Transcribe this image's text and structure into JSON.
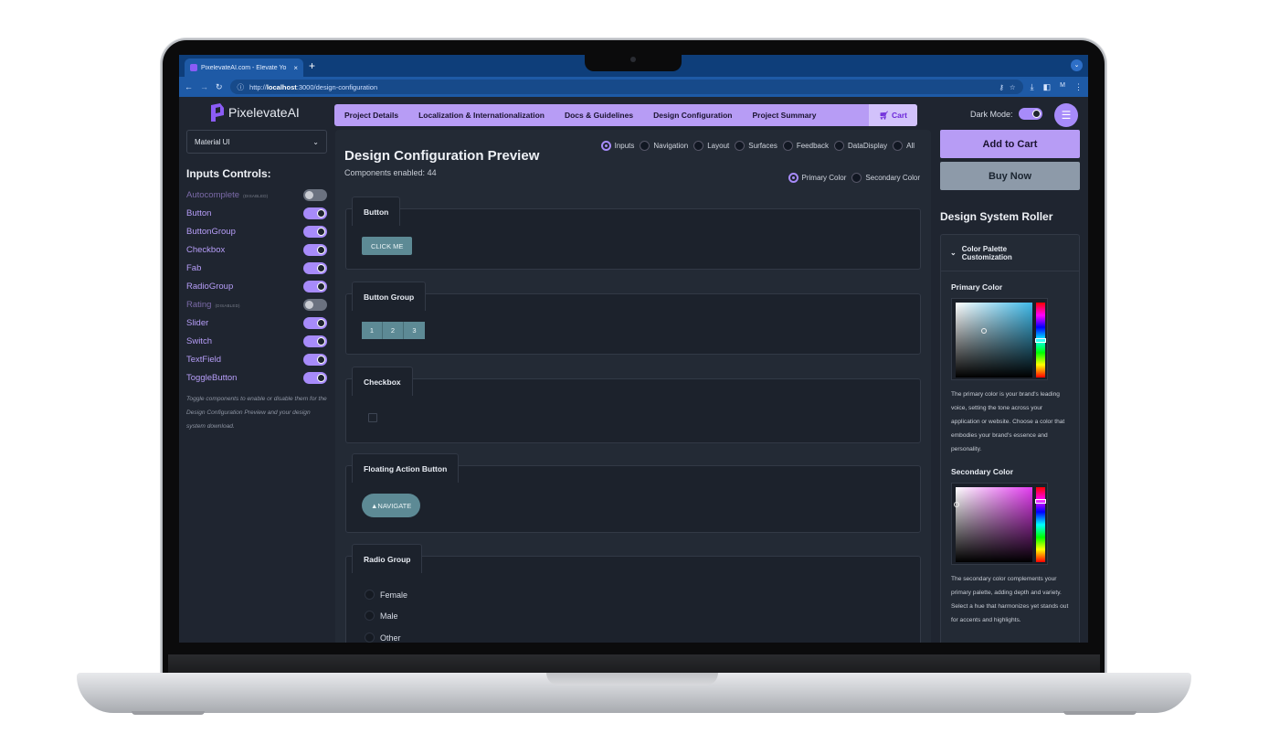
{
  "browser": {
    "tab_title": "PixelevateAI.com - Elevate Yo",
    "tab_close": "×",
    "new_tab": "+",
    "url_prefix": "http://",
    "url_host": "localhost",
    "url_path": ":3000/design-configuration",
    "profile": "M"
  },
  "header": {
    "brand": "PixelevateAI",
    "nav": [
      "Project Details",
      "Localization & Internationalization",
      "Docs & Guidelines",
      "Design Configuration",
      "Project Summary"
    ],
    "cart_label": "Cart",
    "dark_mode_label": "Dark Mode:",
    "dark_mode_on": true
  },
  "sidebar": {
    "library": "Material UI",
    "title": "Inputs Controls:",
    "disabled_tag": "(DISABLED)",
    "controls": [
      {
        "label": "Autocomplete",
        "enabled": false
      },
      {
        "label": "Button",
        "enabled": true
      },
      {
        "label": "ButtonGroup",
        "enabled": true
      },
      {
        "label": "Checkbox",
        "enabled": true
      },
      {
        "label": "Fab",
        "enabled": true
      },
      {
        "label": "RadioGroup",
        "enabled": true
      },
      {
        "label": "Rating",
        "enabled": false
      },
      {
        "label": "Slider",
        "enabled": true
      },
      {
        "label": "Switch",
        "enabled": true
      },
      {
        "label": "TextField",
        "enabled": true
      },
      {
        "label": "ToggleButton",
        "enabled": true
      }
    ],
    "note": "Toggle components to enable or disable them for the Design Configuration Preview and your design system download."
  },
  "preview": {
    "title": "Design Configuration Preview",
    "count_label": "Components enabled: 44",
    "category_filters": [
      {
        "label": "Inputs",
        "selected": true
      },
      {
        "label": "Navigation",
        "selected": false
      },
      {
        "label": "Layout",
        "selected": false
      },
      {
        "label": "Surfaces",
        "selected": false
      },
      {
        "label": "Feedback",
        "selected": false
      },
      {
        "label": "DataDisplay",
        "selected": false
      },
      {
        "label": "All",
        "selected": false
      }
    ],
    "color_filters": [
      {
        "label": "Primary Color",
        "selected": true
      },
      {
        "label": "Secondary Color",
        "selected": false
      }
    ],
    "cards": {
      "button": {
        "title": "Button",
        "button_label": "CLICK ME"
      },
      "button_group": {
        "title": "Button Group",
        "items": [
          "1",
          "2",
          "3"
        ]
      },
      "checkbox": {
        "title": "Checkbox"
      },
      "fab": {
        "title": "Floating Action Button",
        "label": "▲NAVIGATE"
      },
      "radio_group": {
        "title": "Radio Group",
        "options": [
          "Female",
          "Male",
          "Other"
        ]
      }
    }
  },
  "right": {
    "add_to_cart": "Add to Cart",
    "buy_now": "Buy Now",
    "roller_title": "Design System Roller",
    "accordion_title": "Color Palette Customization",
    "primary_label": "Primary Color",
    "primary_desc": "The primary color is your brand's leading voice, setting the tone across your application or website. Choose a color that embodies your brand's essence and personality.",
    "secondary_label": "Secondary Color",
    "secondary_desc": "The secondary color complements your primary palette, adding depth and variety. Select a hue that harmonizes yet stands out for accents and highlights."
  },
  "colors": {
    "accent": "#b79cf5",
    "primary_hue": "#3fb9e8",
    "secondary_hue": "#e33cf0",
    "button": "#5d8a95"
  }
}
